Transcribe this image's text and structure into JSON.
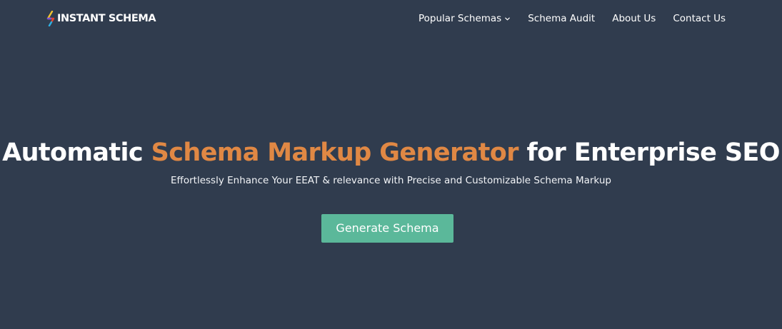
{
  "brand": {
    "name": "INSTANT SCHEMA",
    "logo_icon": "lightning-bolt-icon",
    "logo_colors": [
      "#f2c230",
      "#e0442f",
      "#7a4fe0",
      "#27b0e6"
    ]
  },
  "nav": {
    "items": [
      {
        "label": "Popular Schemas",
        "has_dropdown": true
      },
      {
        "label": "Schema Audit"
      },
      {
        "label": "About Us"
      },
      {
        "label": "Contact Us"
      }
    ]
  },
  "hero": {
    "title_before": "Automatic ",
    "title_accent": "Schema Markup Generator",
    "title_after": " for Enterprise SEO",
    "subtitle": "Effortlessly Enhance Your EEAT & relevance with Precise and Customizable Schema Markup",
    "cta_label": "Generate Schema"
  },
  "colors": {
    "background": "#303c4e",
    "accent": "#e08844",
    "cta_background": "#5bb89a",
    "text": "#ffffff"
  }
}
